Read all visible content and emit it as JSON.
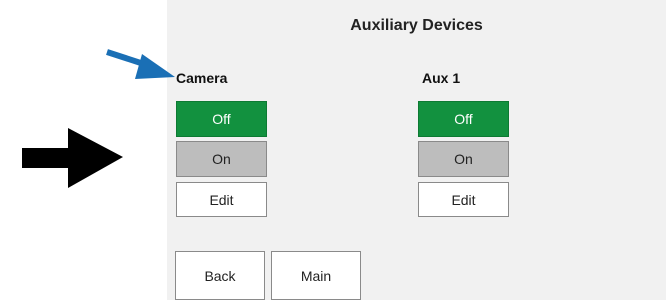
{
  "screen": {
    "title": "Auxiliary Devices"
  },
  "groups": [
    {
      "label": "Camera",
      "off_label": "Off",
      "on_label": "On",
      "edit_label": "Edit",
      "state": "off"
    },
    {
      "label": "Aux 1",
      "off_label": "Off",
      "on_label": "On",
      "edit_label": "Edit",
      "state": "off"
    }
  ],
  "navigation": {
    "back_label": "Back",
    "main_label": "Main"
  },
  "annotations": {
    "blue_arrow_color": "#1a6fb5",
    "black_arrow_color": "#000000"
  },
  "colors": {
    "off_active": "#12913f",
    "on_inactive": "#bdbdbd",
    "panel_background": "#f1f1f1"
  }
}
